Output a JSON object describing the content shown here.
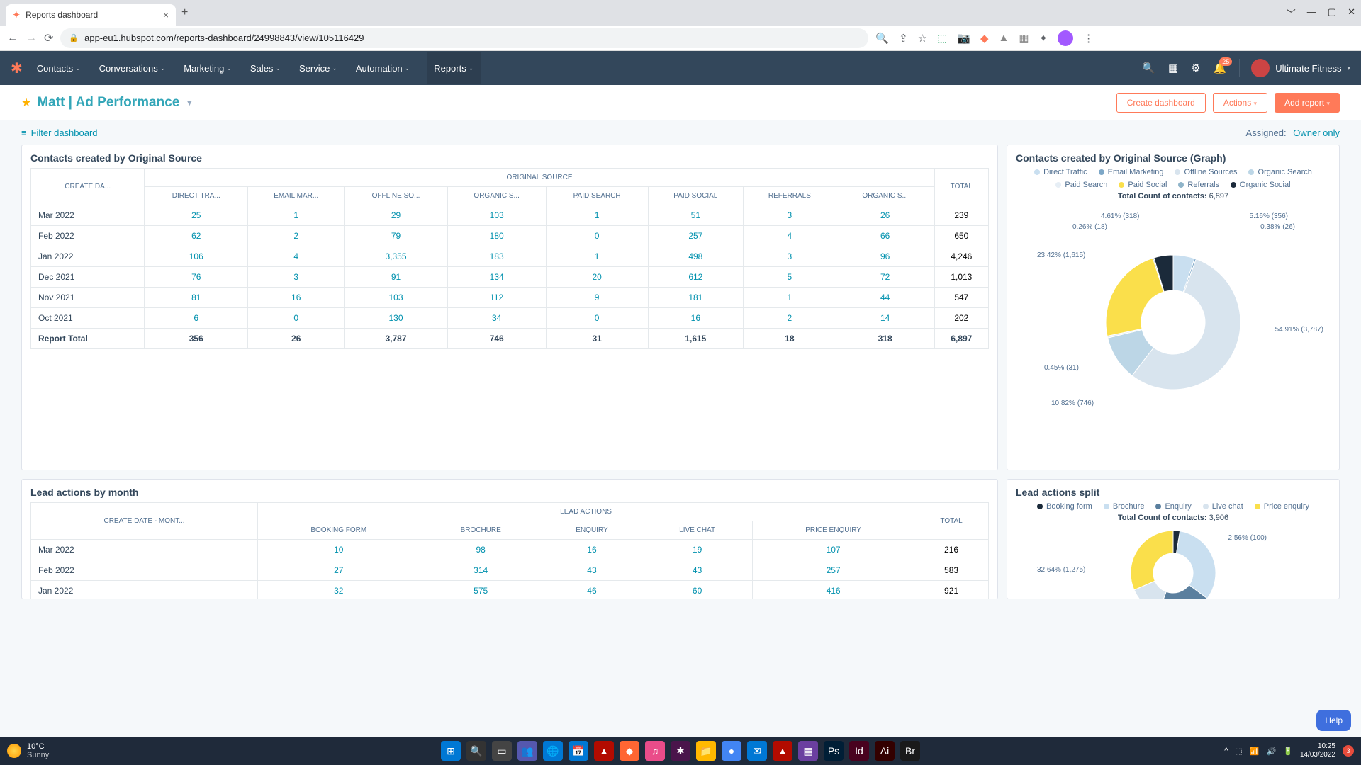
{
  "browser": {
    "tab_title": "Reports dashboard",
    "url": "app-eu1.hubspot.com/reports-dashboard/24998843/view/105116429"
  },
  "hs_nav": {
    "items": [
      "Contacts",
      "Conversations",
      "Marketing",
      "Sales",
      "Service",
      "Automation",
      "Reports"
    ],
    "notif_count": "25",
    "account": "Ultimate Fitness"
  },
  "page": {
    "title": "Matt | Ad Performance",
    "create_dashboard": "Create dashboard",
    "actions": "Actions",
    "add_report": "Add report",
    "filter": "Filter dashboard",
    "assigned_label": "Assigned:",
    "assigned_value": "Owner only"
  },
  "card1": {
    "title": "Contacts created by Original Source",
    "header_group": "ORIGINAL SOURCE",
    "rowhead": "CREATE DA...",
    "cols": [
      "DIRECT TRA...",
      "EMAIL MAR...",
      "OFFLINE SO...",
      "ORGANIC S...",
      "PAID SEARCH",
      "PAID SOCIAL",
      "REFERRALS",
      "ORGANIC S..."
    ],
    "total_col": "TOTAL",
    "rows": [
      {
        "label": "Mar 2022",
        "v": [
          "25",
          "1",
          "29",
          "103",
          "1",
          "51",
          "3",
          "26"
        ],
        "t": "239"
      },
      {
        "label": "Feb 2022",
        "v": [
          "62",
          "2",
          "79",
          "180",
          "0",
          "257",
          "4",
          "66"
        ],
        "t": "650"
      },
      {
        "label": "Jan 2022",
        "v": [
          "106",
          "4",
          "3,355",
          "183",
          "1",
          "498",
          "3",
          "96"
        ],
        "t": "4,246"
      },
      {
        "label": "Dec 2021",
        "v": [
          "76",
          "3",
          "91",
          "134",
          "20",
          "612",
          "5",
          "72"
        ],
        "t": "1,013"
      },
      {
        "label": "Nov 2021",
        "v": [
          "81",
          "16",
          "103",
          "112",
          "9",
          "181",
          "1",
          "44"
        ],
        "t": "547"
      },
      {
        "label": "Oct 2021",
        "v": [
          "6",
          "0",
          "130",
          "34",
          "0",
          "16",
          "2",
          "14"
        ],
        "t": "202"
      }
    ],
    "total_label": "Report Total",
    "totals": [
      "356",
      "26",
      "3,787",
      "746",
      "31",
      "1,615",
      "18",
      "318"
    ],
    "grand": "6,897"
  },
  "card2": {
    "title": "Contacts created by Original Source (Graph)",
    "legend": [
      "Direct Traffic",
      "Email Marketing",
      "Offline Sources",
      "Organic Search",
      "Paid Search",
      "Paid Social",
      "Referrals",
      "Organic Social"
    ],
    "colors": [
      "#c9dff0",
      "#7da7c7",
      "#d8e4ee",
      "#bcd6e6",
      "#e6eef5",
      "#fadf4b",
      "#8fb4c9",
      "#1b2a3a"
    ],
    "total_label": "Total Count of contacts:",
    "total_value": "6,897",
    "slice_labels": [
      "5.16% (356)",
      "0.38% (26)",
      "54.91% (3,787)",
      "10.82% (746)",
      "0.45% (31)",
      "23.42% (1,615)",
      "0.26% (18)",
      "4.61% (318)"
    ]
  },
  "card3": {
    "title": "Lead actions by month",
    "header_group": "LEAD ACTIONS",
    "rowhead": "CREATE DATE - MONT...",
    "cols": [
      "BOOKING FORM",
      "BROCHURE",
      "ENQUIRY",
      "LIVE CHAT",
      "PRICE ENQUIRY"
    ],
    "total_col": "TOTAL",
    "rows": [
      {
        "label": "Mar 2022",
        "v": [
          "10",
          "98",
          "16",
          "19",
          "107"
        ],
        "t": "216"
      },
      {
        "label": "Feb 2022",
        "v": [
          "27",
          "314",
          "43",
          "43",
          "257"
        ],
        "t": "583"
      },
      {
        "label": "Jan 2022",
        "v": [
          "32",
          "575",
          "46",
          "60",
          "416"
        ],
        "t": "921"
      }
    ]
  },
  "card4": {
    "title": "Lead actions split",
    "legend": [
      "Booking form",
      "Brochure",
      "Enquiry",
      "Live chat",
      "Price enquiry"
    ],
    "colors": [
      "#1b2a3a",
      "#c9dff0",
      "#5a7f9e",
      "#d8e4ee",
      "#fadf4b"
    ],
    "total_label": "Total Count of contacts:",
    "total_value": "3,906",
    "slice_labels": [
      "2.56% (100)",
      "32.64% (1,275)"
    ]
  },
  "chart_data": [
    {
      "type": "pie",
      "title": "Contacts created by Original Source",
      "series": [
        {
          "name": "Direct Traffic",
          "value": 356
        },
        {
          "name": "Email Marketing",
          "value": 26
        },
        {
          "name": "Offline Sources",
          "value": 3787
        },
        {
          "name": "Organic Search",
          "value": 746
        },
        {
          "name": "Paid Search",
          "value": 31
        },
        {
          "name": "Paid Social",
          "value": 1615
        },
        {
          "name": "Referrals",
          "value": 18
        },
        {
          "name": "Organic Social",
          "value": 318
        }
      ],
      "total": 6897
    },
    {
      "type": "pie",
      "title": "Lead actions split",
      "series": [
        {
          "name": "Booking form",
          "value": 100
        },
        {
          "name": "Brochure",
          "value": 1275
        },
        {
          "name": "Enquiry",
          "value": null
        },
        {
          "name": "Live chat",
          "value": null
        },
        {
          "name": "Price enquiry",
          "value": null
        }
      ],
      "total": 3906
    }
  ],
  "help": "Help",
  "taskbar": {
    "temp": "10°C",
    "weather": "Sunny",
    "time": "10:25",
    "date": "14/03/2022",
    "notif": "3"
  }
}
